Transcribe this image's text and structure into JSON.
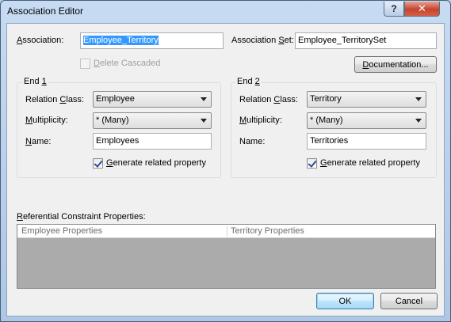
{
  "window": {
    "title": "Association Editor",
    "help_glyph": "?",
    "close_glyph": "✕"
  },
  "association": {
    "label_pre": "",
    "label_underline": "A",
    "label_post": "ssociation:",
    "value": "Employee_Territory",
    "set_label_pre": "Association ",
    "set_label_underline": "S",
    "set_label_post": "et:",
    "set_value": "Employee_TerritorySet"
  },
  "delete_cascaded": {
    "label_underline": "D",
    "label_post": "elete Cascaded",
    "checked": false,
    "enabled": false
  },
  "documentation_button": {
    "label_underline": "D",
    "label_post": "ocumentation..."
  },
  "end1": {
    "title_pre": "End ",
    "title_underline": "1",
    "relation_label_pre": "Relation ",
    "relation_label_underline": "C",
    "relation_label_post": "lass:",
    "relation_value": "Employee",
    "multiplicity_label_underline": "M",
    "multiplicity_label_post": "ultiplicity:",
    "multiplicity_value": "* (Many)",
    "name_label_underline": "N",
    "name_label_post": "ame:",
    "name_value": "Employees",
    "generate_label_underline": "G",
    "generate_label_post": "enerate related property",
    "generate_checked": true
  },
  "end2": {
    "title_pre": "End ",
    "title_underline": "2",
    "relation_label_pre": "Relation ",
    "relation_label_underline": "C",
    "relation_label_post": "lass:",
    "relation_value": "Territory",
    "multiplicity_label_underline": "M",
    "multiplicity_label_post": "ultiplicity:",
    "multiplicity_value": "* (Many)",
    "name_label": "Name:",
    "name_value": "Territories",
    "generate_label_underline": "G",
    "generate_label_post": "enerate related property",
    "generate_checked": true
  },
  "referential": {
    "label_underline": "R",
    "label_post": "eferential Constraint Properties:",
    "columns": [
      "Employee Properties",
      "Territory Properties"
    ]
  },
  "buttons": {
    "ok": "OK",
    "cancel": "Cancel"
  }
}
